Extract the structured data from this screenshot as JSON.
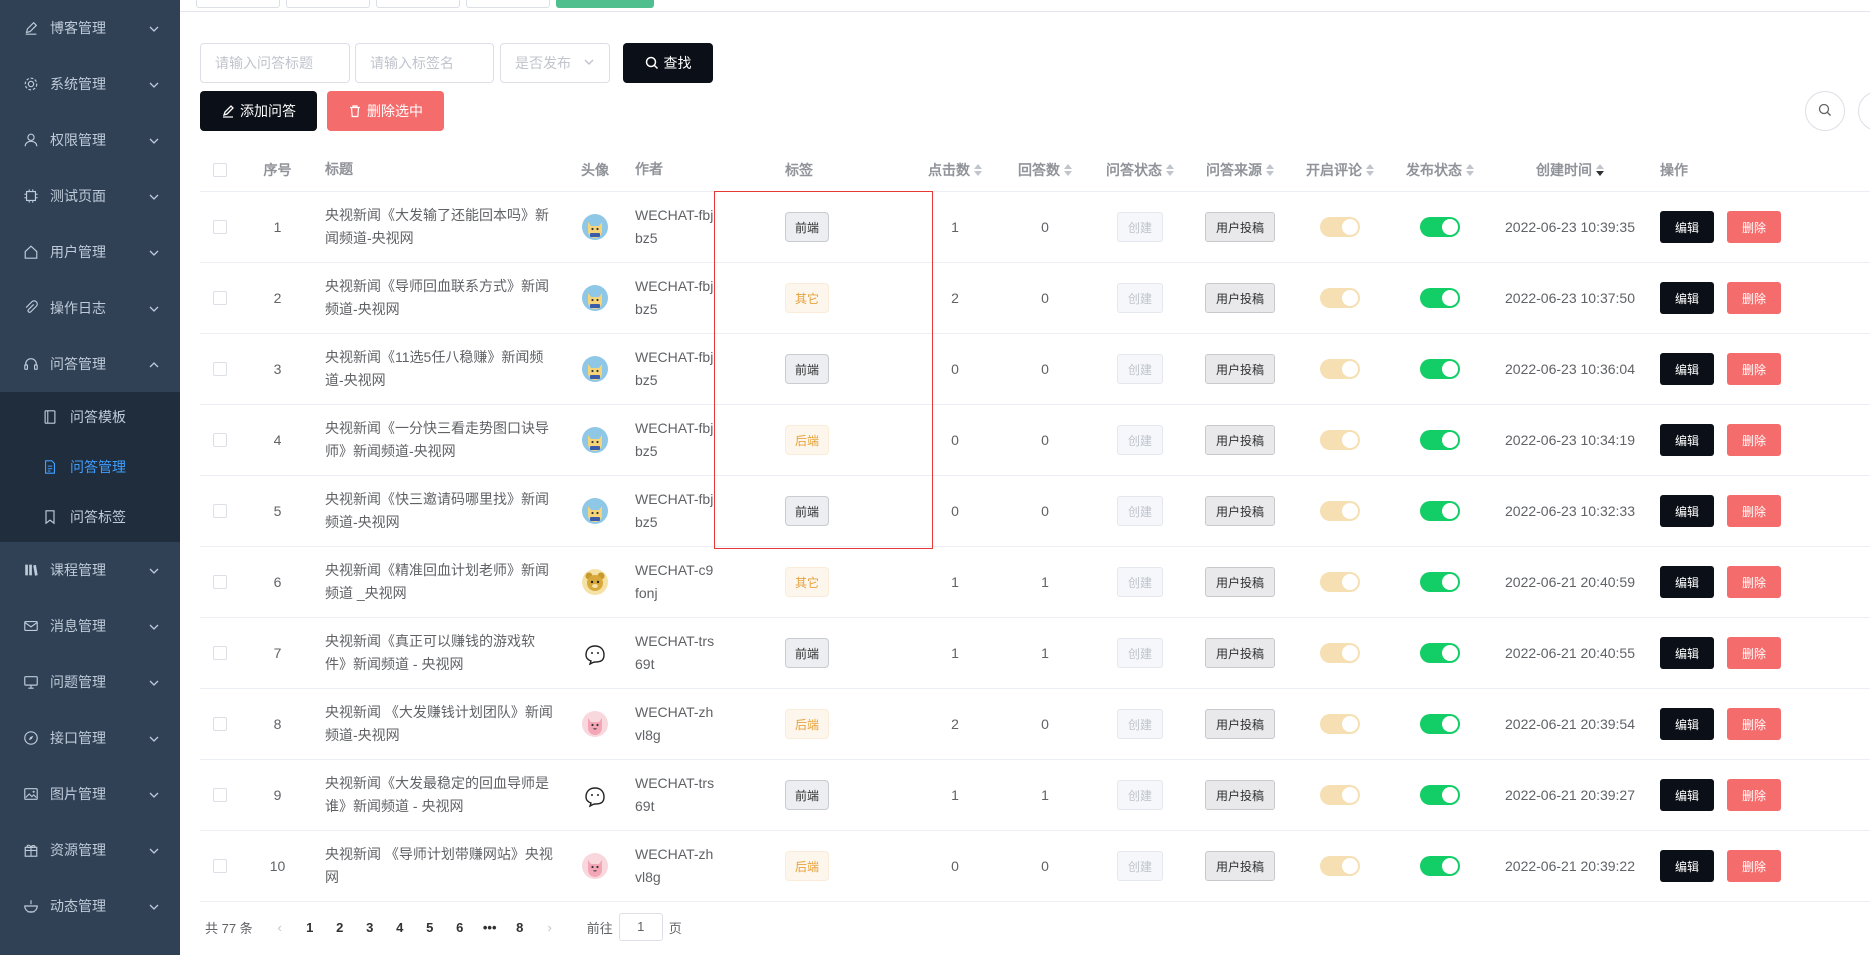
{
  "sidebar": {
    "items": [
      {
        "label": "博客管理",
        "icon": "pen-icon"
      },
      {
        "label": "系统管理",
        "icon": "gear-icon"
      },
      {
        "label": "权限管理",
        "icon": "user-icon"
      },
      {
        "label": "测试页面",
        "icon": "chip-icon"
      },
      {
        "label": "用户管理",
        "icon": "home-icon"
      },
      {
        "label": "操作日志",
        "icon": "paperclip-icon"
      },
      {
        "label": "问答管理",
        "icon": "headset-icon"
      }
    ],
    "sub_items": [
      {
        "label": "问答模板",
        "icon": "notebook-icon"
      },
      {
        "label": "问答管理",
        "icon": "document-icon"
      },
      {
        "label": "问答标签",
        "icon": "bookmark-icon"
      }
    ],
    "items_after": [
      {
        "label": "课程管理",
        "icon": "books-icon"
      },
      {
        "label": "消息管理",
        "icon": "mail-icon"
      },
      {
        "label": "问题管理",
        "icon": "monitor-icon"
      },
      {
        "label": "接口管理",
        "icon": "compass-icon"
      },
      {
        "label": "图片管理",
        "icon": "picture-icon"
      },
      {
        "label": "资源管理",
        "icon": "gift-icon"
      },
      {
        "label": "动态管理",
        "icon": "bowl-icon"
      }
    ]
  },
  "filters": {
    "title_placeholder": "请输入问答标题",
    "tag_placeholder": "请输入标签名",
    "publish_placeholder": "是否发布",
    "search_label": "查找"
  },
  "actions": {
    "add_label": "添加问答",
    "delete_selected_label": "删除选中"
  },
  "table": {
    "headers": {
      "index": "序号",
      "title": "标题",
      "avatar": "头像",
      "author": "作者",
      "tag": "标签",
      "clicks": "点击数",
      "answers": "回答数",
      "answer_status": "问答状态",
      "source": "问答来源",
      "comment": "开启评论",
      "publish": "发布状态",
      "created": "创建时间",
      "ops": "操作"
    },
    "status_label": "创建",
    "source_label": "用户投稿",
    "edit_label": "编辑",
    "delete_label": "删除",
    "rows": [
      {
        "index": "1",
        "title": "央视新闻《大发输了还能回本吗》新闻频道-央视网",
        "author": "WECHAT-fbjbz5",
        "avatar": "cat-avatar",
        "tag": "前端",
        "tag_style": "gray",
        "clicks": "1",
        "answers": "0",
        "comment_on": false,
        "publish_on": true,
        "created": "2022-06-23 10:39:35"
      },
      {
        "index": "2",
        "title": "央视新闻《导师回血联系方式》新闻频道-央视网",
        "author": "WECHAT-fbjbz5",
        "avatar": "cat-avatar",
        "tag": "其它",
        "tag_style": "orange",
        "clicks": "2",
        "answers": "0",
        "comment_on": false,
        "publish_on": true,
        "created": "2022-06-23 10:37:50"
      },
      {
        "index": "3",
        "title": "央视新闻《11选5任八稳赚》新闻频道-央视网",
        "author": "WECHAT-fbjbz5",
        "avatar": "cat-avatar",
        "tag": "前端",
        "tag_style": "gray",
        "clicks": "0",
        "answers": "0",
        "comment_on": false,
        "publish_on": true,
        "created": "2022-06-23 10:36:04"
      },
      {
        "index": "4",
        "title": "央视新闻《一分快三看走势图口诀导师》新闻频道-央视网",
        "author": "WECHAT-fbjbz5",
        "avatar": "cat-avatar",
        "tag": "后端",
        "tag_style": "orange",
        "clicks": "0",
        "answers": "0",
        "comment_on": false,
        "publish_on": true,
        "created": "2022-06-23 10:34:19"
      },
      {
        "index": "5",
        "title": "央视新闻《快三邀请码哪里找》新闻频道-央视网",
        "author": "WECHAT-fbjbz5",
        "avatar": "cat-avatar",
        "tag": "前端",
        "tag_style": "gray",
        "clicks": "0",
        "answers": "0",
        "comment_on": false,
        "publish_on": true,
        "created": "2022-06-23 10:32:33"
      },
      {
        "index": "6",
        "title": "央视新闻《精准回血计划老师》新闻频道 _央视网",
        "author": "WECHAT-c9fonj",
        "avatar": "bear-avatar",
        "tag": "其它",
        "tag_style": "orange",
        "clicks": "1",
        "answers": "1",
        "comment_on": false,
        "publish_on": true,
        "created": "2022-06-21 20:40:59"
      },
      {
        "index": "7",
        "title": "央视新闻《真正可以赚钱的游戏软件》新闻频道 - 央视网",
        "author": "WECHAT-trs69t",
        "avatar": "sketch-avatar",
        "tag": "前端",
        "tag_style": "gray",
        "clicks": "1",
        "answers": "1",
        "comment_on": false,
        "publish_on": true,
        "created": "2022-06-21 20:40:55"
      },
      {
        "index": "8",
        "title": "央视新闻 《大发赚钱计划团队》新闻频道-央视网",
        "author": "WECHAT-zhvl8g",
        "avatar": "pink-cat-avatar",
        "tag": "后端",
        "tag_style": "orange",
        "clicks": "2",
        "answers": "0",
        "comment_on": false,
        "publish_on": true,
        "created": "2022-06-21 20:39:54"
      },
      {
        "index": "9",
        "title": "央视新闻《大发最稳定的回血导师是谁》新闻频道 - 央视网",
        "author": "WECHAT-trs69t",
        "avatar": "sketch-avatar",
        "tag": "前端",
        "tag_style": "gray",
        "clicks": "1",
        "answers": "1",
        "comment_on": false,
        "publish_on": true,
        "created": "2022-06-21 20:39:27"
      },
      {
        "index": "10",
        "title": "央视新闻 《导师计划带赚网站》央视网",
        "author": "WECHAT-zhvl8g",
        "avatar": "pink-cat-avatar",
        "tag": "后端",
        "tag_style": "orange",
        "clicks": "0",
        "answers": "0",
        "comment_on": false,
        "publish_on": true,
        "created": "2022-06-21 20:39:22"
      }
    ]
  },
  "pagination": {
    "total": "共 77 条",
    "pages": [
      "1",
      "2",
      "3",
      "4",
      "5",
      "6",
      "•••",
      "8"
    ],
    "goto_prefix": "前往",
    "goto_value": "1",
    "goto_suffix": "页"
  },
  "colors": {
    "sidebar_bg": "#304156",
    "accent": "#409eff",
    "danger": "#f56c6c",
    "success": "#13ce66"
  }
}
